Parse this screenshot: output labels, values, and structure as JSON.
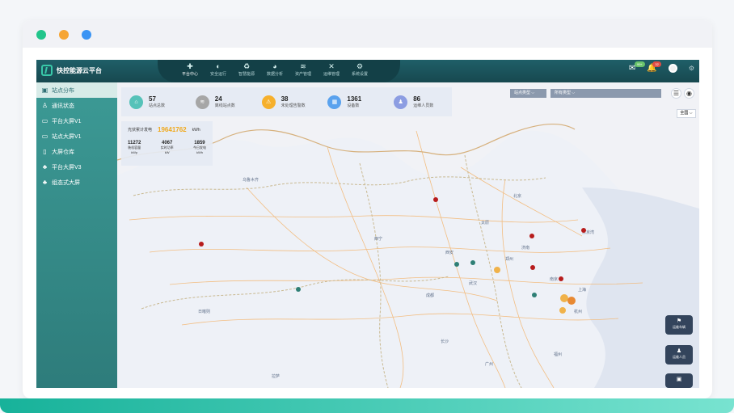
{
  "window": {
    "dots": [
      "#22c58b",
      "#f6a534",
      "#3b94f4"
    ]
  },
  "app": {
    "title": "快控能源云平台"
  },
  "nav": [
    {
      "label": "平台中心",
      "icon": "✚",
      "active": true
    },
    {
      "label": "安全运行",
      "icon": "◐"
    },
    {
      "label": "智慧能源",
      "icon": "♻"
    },
    {
      "label": "数据分析",
      "icon": "◕"
    },
    {
      "label": "资产管理",
      "icon": "≋"
    },
    {
      "label": "运维管理",
      "icon": "✕"
    },
    {
      "label": "系统设置",
      "icon": "⚙"
    }
  ],
  "top": {
    "badge1": "99+",
    "badge2": "32"
  },
  "sidebar": [
    {
      "label": "站点分布",
      "icon": "▣",
      "active": true
    },
    {
      "label": "通讯状态",
      "icon": "♙"
    },
    {
      "label": "平台大屏V1",
      "icon": "▭"
    },
    {
      "label": "站点大屏V1",
      "icon": "▭"
    },
    {
      "label": "大屏仓库",
      "icon": "▯"
    },
    {
      "label": "平台大屏V3",
      "icon": "♣"
    },
    {
      "label": "组态式大屏",
      "icon": "♣"
    }
  ],
  "stats": [
    {
      "value": "57",
      "label": "站点总数",
      "color": "#56c2b9",
      "icon": "⌂"
    },
    {
      "value": "24",
      "label": "离线站点数",
      "color": "#a6a6a6",
      "icon": "≋"
    },
    {
      "value": "38",
      "label": "未处理告警数",
      "color": "#f6b02c",
      "icon": "⚠"
    },
    {
      "value": "1361",
      "label": "设备数",
      "color": "#5aa2ee",
      "icon": "▦"
    },
    {
      "value": "86",
      "label": "运维人员数",
      "color": "#8c9de2",
      "icon": "♟"
    }
  ],
  "energy": {
    "label": "光伏累计发电",
    "value": "19641762",
    "unit": "kWh",
    "cells": [
      {
        "value": "11272",
        "label": "装机容量",
        "unit": "kWp"
      },
      {
        "value": "4067",
        "label": "实时功率",
        "unit": "kW"
      },
      {
        "value": "1859",
        "label": "今日发电",
        "unit": "kWh"
      }
    ]
  },
  "map": {
    "select1": "站点类型 ⌵",
    "select2": "所有类型 ⌵",
    "all_label": "全国 ⌵",
    "float_btns": [
      {
        "label": "运维车辆",
        "icon": "⚑"
      },
      {
        "label": "运维人员",
        "icon": "♟"
      },
      {
        "label": "",
        "icon": "▣"
      }
    ]
  }
}
